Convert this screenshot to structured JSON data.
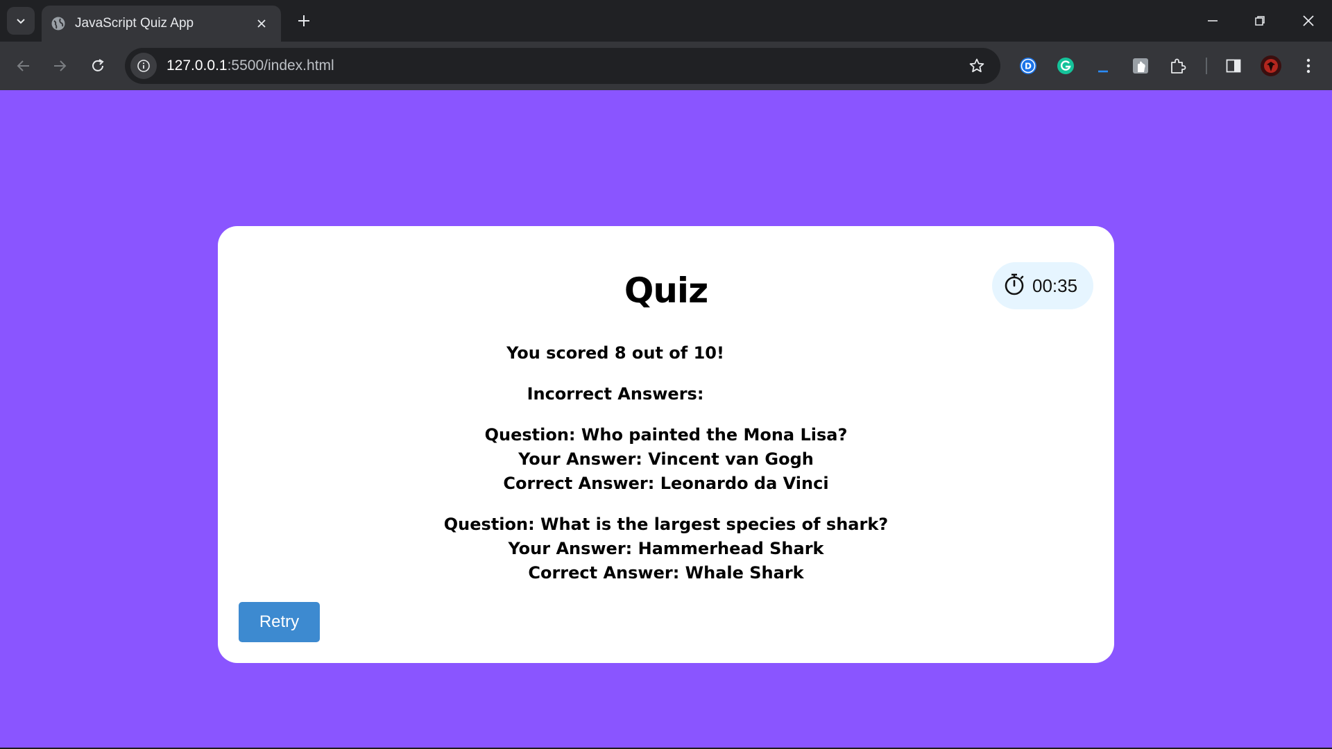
{
  "browser": {
    "tab_title": "JavaScript Quiz App",
    "url_host": "127.0.0.1",
    "url_path": ":5500/index.html",
    "icons": [
      "tab-search-icon",
      "globe-icon",
      "close-icon",
      "plus-icon",
      "minimize-icon",
      "restore-icon",
      "close-window-icon",
      "back-arrow-icon",
      "forward-arrow-icon",
      "reload-icon",
      "info-icon",
      "star-icon",
      "extension-d-icon",
      "grammarly-icon",
      "underscore-extension-icon",
      "tile-extension-icon",
      "puzzle-icon",
      "side-panel-icon",
      "profile-avatar",
      "kebab-menu-icon"
    ]
  },
  "quiz": {
    "title": "Quiz",
    "timer": "00:35",
    "score_text": "You scored 8 out of 10!",
    "incorrect_heading": "Incorrect Answers:",
    "incorrect": [
      {
        "question": "Question: Who painted the Mona Lisa?",
        "your_answer": "Your Answer: Vincent van Gogh",
        "correct_answer": "Correct Answer: Leonardo da Vinci"
      },
      {
        "question": "Question: What is the largest species of shark?",
        "your_answer": "Your Answer: Hammerhead Shark",
        "correct_answer": "Correct Answer: Whale Shark"
      }
    ],
    "retry_label": "Retry"
  },
  "colors": {
    "page_background": "#8a55ff",
    "card_background": "#ffffff",
    "timer_background": "#e6f5ff",
    "retry_button": "#3d8ad0"
  }
}
